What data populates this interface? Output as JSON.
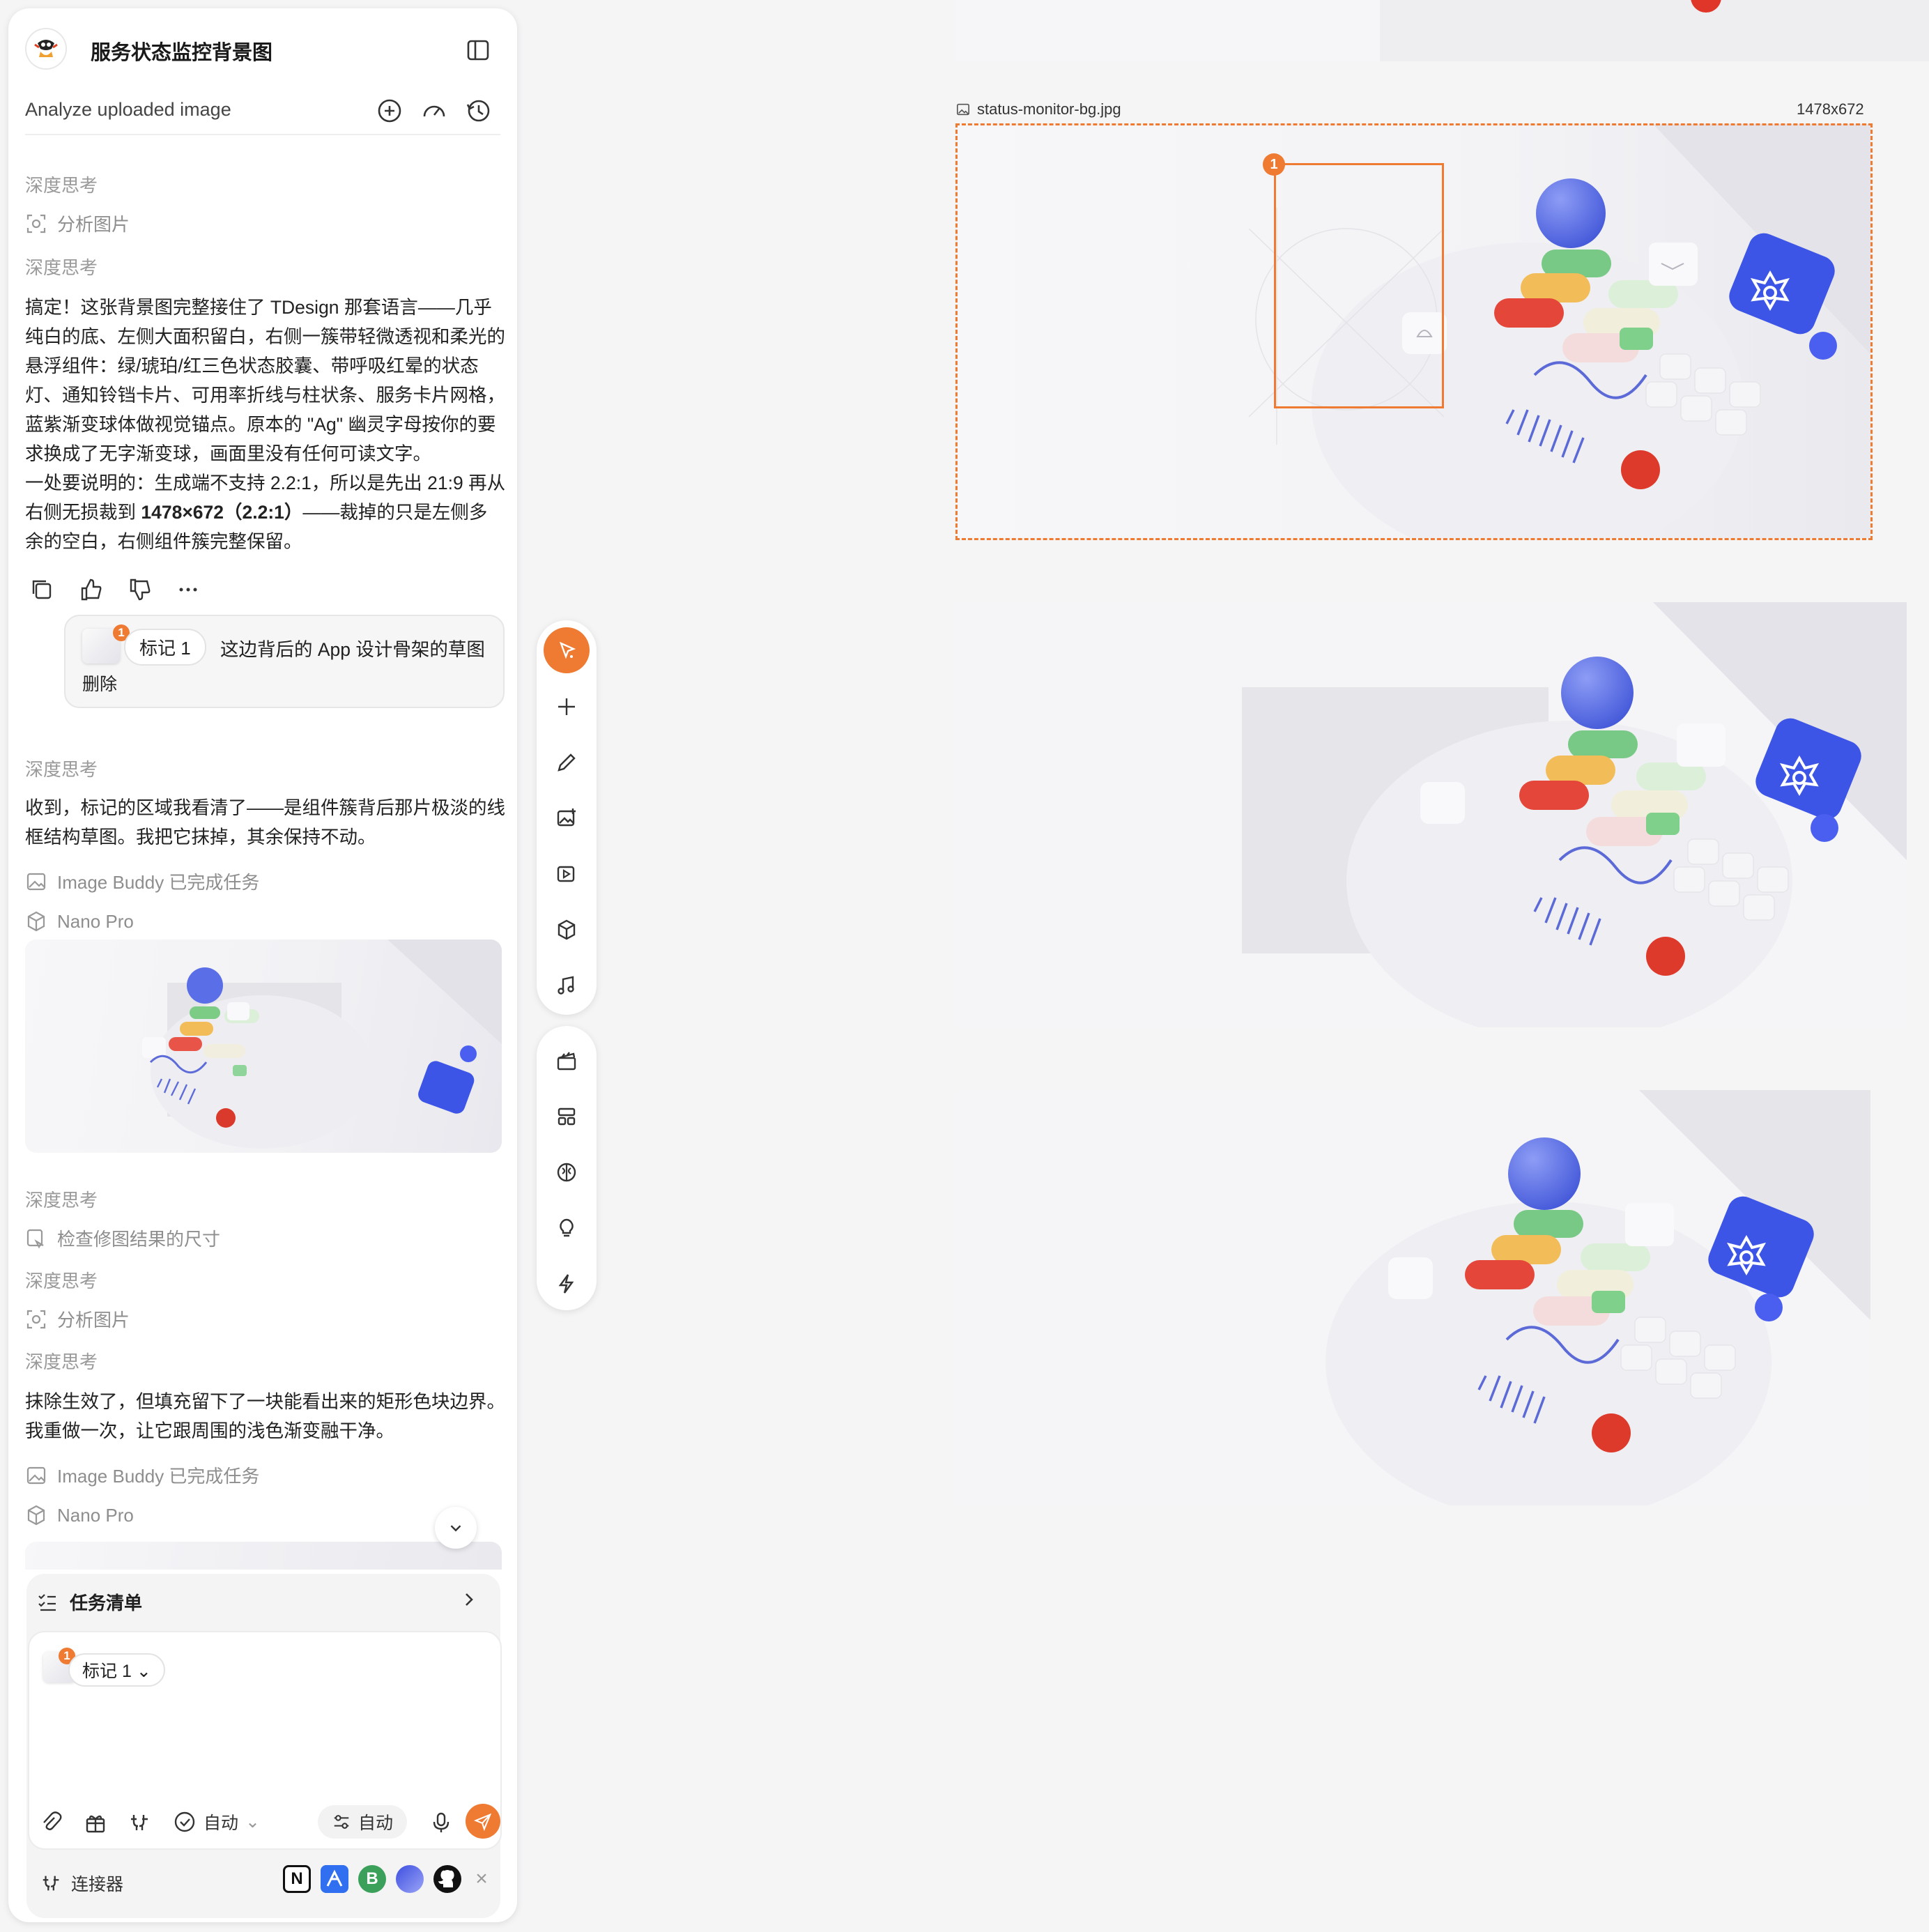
{
  "header": {
    "title": "服务状态监控背景图",
    "subtitle": "Analyze uploaded image"
  },
  "chat": {
    "think1": "深度思考",
    "analyze1": "分析图片",
    "think2": "深度思考",
    "reply1_lines": [
      "搞定！这张背景图完整接住了 TDesign 那套语言——几乎",
      "纯白的底、左侧大面积留白，右侧一簇带轻微透视和柔光的",
      "悬浮组件：绿/琥珀/红三色状态胶囊、带呼吸红晕的状态",
      "灯、通知铃铛卡片、可用率折线与柱状条、服务卡片网格，",
      "蓝紫渐变球体做视觉锚点。原本的 \"Ag\" 幽灵字母按你的要",
      "求换成了无字渐变球，画面里没有任何可读文字。",
      "一处要说明的：生成端不支持 2.2:1，所以是先出 21:9 再从",
      "右侧无损裁到"
    ],
    "reply1_bold": "1478×672（2.2:1）",
    "reply1_tail": "——裁掉的只是左侧多",
    "reply1_last": "余的空白，右侧组件簇完整保留。",
    "mark_chip": "标记 1",
    "mark_text": "这边背后的 App 设计骨架的草图",
    "mark_delete": "删除",
    "think3": "深度思考",
    "reply2_lines": [
      "收到，标记的区域我看清了——是组件簇背后那片极淡的线",
      "框结构草图。我把它抹掉，其余保持不动。"
    ],
    "task_done1": "Image Buddy 已完成任务",
    "model1": "Nano Pro",
    "think4": "深度思考",
    "check_size": "检查修图结果的尺寸",
    "think5": "深度思考",
    "analyze2": "分析图片",
    "think6": "深度思考",
    "reply3_lines": [
      "抹除生效了，但填充留下了一块能看出来的矩形色块边界。",
      "我重做一次，让它跟周围的浅色渐变融干净。"
    ],
    "task_done2": "Image Buddy 已完成任务",
    "model2": "Nano Pro"
  },
  "composer": {
    "task_list": "任务清单",
    "mark_chip": "标记 1",
    "mode_auto": "自动",
    "pill_auto": "自动",
    "connectors": "连接器"
  },
  "canvas": {
    "file_name": "status-monitor-bg.jpg",
    "dimensions": "1478x672",
    "marker_number": "1"
  },
  "colors": {
    "accent": "#ef7a32",
    "blue_tile": "#3d55e6",
    "status_red": "#e0362a",
    "status_green": "#6cc77a",
    "status_amber": "#f0b64a"
  }
}
